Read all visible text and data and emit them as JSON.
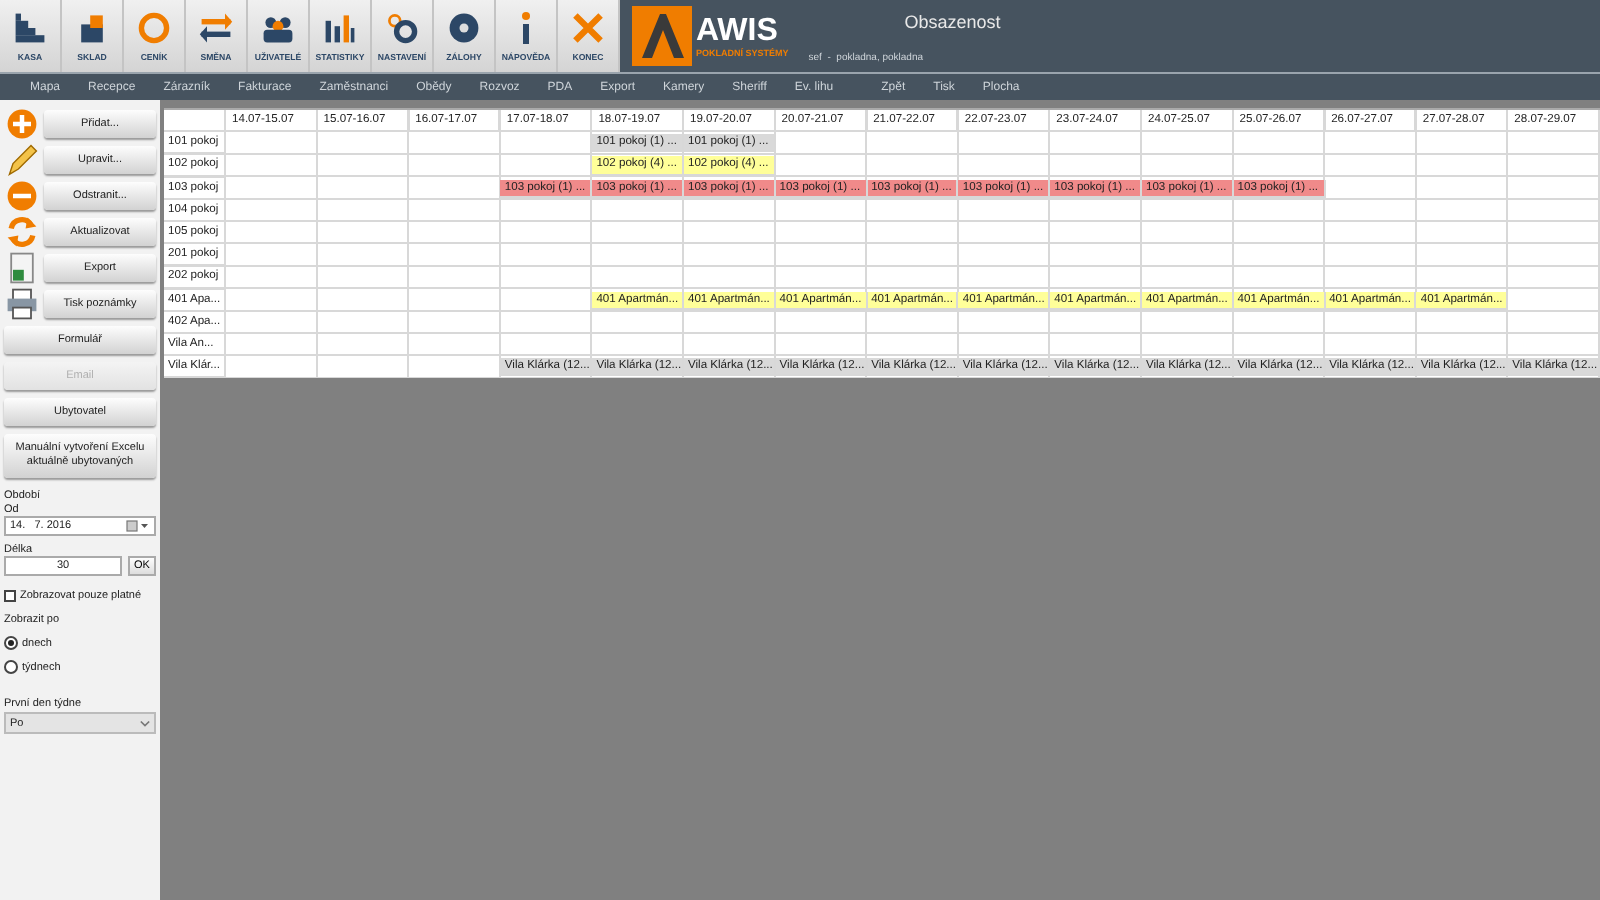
{
  "toolbar": {
    "buttons": [
      {
        "label": "KASA",
        "kind": "stairs"
      },
      {
        "label": "SKLAD",
        "kind": "box"
      },
      {
        "label": "CENÍK",
        "kind": "coin"
      },
      {
        "label": "SMĚNA",
        "kind": "swap"
      },
      {
        "label": "UŽIVATELÉ",
        "kind": "users"
      },
      {
        "label": "STATISTIKY",
        "kind": "bars"
      },
      {
        "label": "NASTAVENÍ",
        "kind": "gears"
      },
      {
        "label": "ZÁLOHY",
        "kind": "disc"
      },
      {
        "label": "NÁPOVĚDA",
        "kind": "info"
      },
      {
        "label": "KONEC",
        "kind": "close"
      }
    ]
  },
  "logo": {
    "name": "AWIS",
    "subtitle": "POKLADNÍ SYSTÉMY"
  },
  "header": {
    "title": "Obsazenost",
    "user": "sef  -  pokladna, pokladna"
  },
  "nav": {
    "items": [
      "Mapa",
      "Recepce",
      "Zárazník",
      "Fakturace",
      "Zaměstnanci",
      "Obědy",
      "Rozvoz",
      "PDA",
      "Export",
      "Kamery",
      "Sheriff",
      "Ev. lihu",
      "Zpět",
      "Tisk",
      "Plocha"
    ]
  },
  "sidebar": {
    "buttons": [
      {
        "label": "Přidat...",
        "kind": "plus",
        "disabled": false
      },
      {
        "label": "Upravit...",
        "kind": "pencil",
        "disabled": false
      },
      {
        "label": "Odstranit...",
        "kind": "minus",
        "disabled": false
      },
      {
        "label": "Aktualizovat",
        "kind": "refresh",
        "disabled": false
      },
      {
        "label": "Export",
        "kind": "sheet",
        "disabled": false
      },
      {
        "label": "Tisk poznámky",
        "kind": "printer",
        "disabled": false
      },
      {
        "label": "Formulář",
        "kind": "plain",
        "disabled": false
      },
      {
        "label": "Email",
        "kind": "plain",
        "disabled": true
      },
      {
        "label": "Ubytovatel",
        "kind": "plain",
        "disabled": false
      },
      {
        "label": "Manuální vytvoření Excelu aktuálně ubytovaných",
        "kind": "plain",
        "disabled": false
      }
    ],
    "period_label": "Období",
    "from_label": "Od",
    "from_value": "14.   7. 2016",
    "length_label": "Délka",
    "length_value": "30",
    "ok_button": "OK",
    "only_valid": {
      "label": "Zobrazovat pouze platné",
      "checked": false
    },
    "show_by_label": "Zobrazit po",
    "show_by": [
      {
        "label": "dnech",
        "selected": true
      },
      {
        "label": "týdnech",
        "selected": false
      }
    ],
    "first_day_label": "První den týdne",
    "first_day_value": "Po"
  },
  "grid": {
    "columns": [
      "14.07-15.07",
      "15.07-16.07",
      "16.07-17.07",
      "17.07-18.07",
      "18.07-19.07",
      "19.07-20.07",
      "20.07-21.07",
      "21.07-22.07",
      "22.07-23.07",
      "23.07-24.07",
      "24.07-25.07",
      "25.07-26.07",
      "26.07-27.07",
      "27.07-28.07",
      "28.07-29.07"
    ],
    "rows": [
      {
        "label": "101 pokoj",
        "cells": [
          null,
          null,
          null,
          null,
          {
            "text": "101 pokoj (1) ...",
            "color": "#d9d9d9"
          },
          {
            "text": "101 pokoj (1) ...",
            "color": "#d9d9d9"
          },
          null,
          null,
          null,
          null,
          null,
          null,
          null,
          null,
          null
        ]
      },
      {
        "label": "102 pokoj",
        "cells": [
          null,
          null,
          null,
          null,
          {
            "text": "102 pokoj (4) ...",
            "color": "#ffff99"
          },
          {
            "text": "102 pokoj (4) ...",
            "color": "#ffff99"
          },
          null,
          null,
          null,
          null,
          null,
          null,
          null,
          null,
          null
        ]
      },
      {
        "label": "103 pokoj",
        "cells": [
          null,
          null,
          null,
          {
            "text": "103 pokoj (1) ...",
            "color": "#f08a8a"
          },
          {
            "text": "103 pokoj (1) ...",
            "color": "#f08a8a"
          },
          {
            "text": "103 pokoj (1) ...",
            "color": "#f08a8a"
          },
          {
            "text": "103 pokoj (1) ...",
            "color": "#f08a8a"
          },
          {
            "text": "103 pokoj (1) ...",
            "color": "#f08a8a"
          },
          {
            "text": "103 pokoj (1) ...",
            "color": "#f08a8a"
          },
          {
            "text": "103 pokoj (1) ...",
            "color": "#f08a8a"
          },
          {
            "text": "103 pokoj (1) ...",
            "color": "#f08a8a"
          },
          {
            "text": "103 pokoj (1) ...",
            "color": "#f08a8a"
          },
          null,
          null,
          null
        ]
      },
      {
        "label": "104 pokoj",
        "cells": [
          null,
          null,
          null,
          null,
          null,
          null,
          null,
          null,
          null,
          null,
          null,
          null,
          null,
          null,
          null
        ]
      },
      {
        "label": "105 pokoj",
        "cells": [
          null,
          null,
          null,
          null,
          null,
          null,
          null,
          null,
          null,
          null,
          null,
          null,
          null,
          null,
          null
        ]
      },
      {
        "label": "201 pokoj",
        "cells": [
          null,
          null,
          null,
          null,
          null,
          null,
          null,
          null,
          null,
          null,
          null,
          null,
          null,
          null,
          null
        ]
      },
      {
        "label": "202 pokoj",
        "cells": [
          null,
          null,
          null,
          null,
          null,
          null,
          null,
          null,
          null,
          null,
          null,
          null,
          null,
          null,
          null
        ]
      },
      {
        "label": "401 Apa...",
        "cells": [
          null,
          null,
          null,
          null,
          {
            "text": "401 Apartmán...",
            "color": "#ffff99"
          },
          {
            "text": "401 Apartmán...",
            "color": "#ffff99"
          },
          {
            "text": "401 Apartmán...",
            "color": "#ffff99"
          },
          {
            "text": "401 Apartmán...",
            "color": "#ffff99"
          },
          {
            "text": "401 Apartmán...",
            "color": "#ffff99"
          },
          {
            "text": "401 Apartmán...",
            "color": "#ffff99"
          },
          {
            "text": "401 Apartmán...",
            "color": "#ffff99"
          },
          {
            "text": "401 Apartmán...",
            "color": "#ffff99"
          },
          {
            "text": "401 Apartmán...",
            "color": "#ffff99"
          },
          {
            "text": "401 Apartmán...",
            "color": "#ffff99"
          },
          null
        ]
      },
      {
        "label": "402 Apa...",
        "cells": [
          null,
          null,
          null,
          null,
          null,
          null,
          null,
          null,
          null,
          null,
          null,
          null,
          null,
          null,
          null
        ]
      },
      {
        "label": "Vila An...",
        "cells": [
          null,
          null,
          null,
          null,
          null,
          null,
          null,
          null,
          null,
          null,
          null,
          null,
          null,
          null,
          null
        ]
      },
      {
        "label": "Vila Klár...",
        "cells": [
          null,
          null,
          null,
          {
            "text": "Vila Klárka (12...",
            "color": "#d9d9d9"
          },
          {
            "text": "Vila Klárka (12...",
            "color": "#d9d9d9"
          },
          {
            "text": "Vila Klárka (12...",
            "color": "#d9d9d9"
          },
          {
            "text": "Vila Klárka (12...",
            "color": "#d9d9d9"
          },
          {
            "text": "Vila Klárka (12...",
            "color": "#d9d9d9"
          },
          {
            "text": "Vila Klárka (12...",
            "color": "#d9d9d9"
          },
          {
            "text": "Vila Klárka (12...",
            "color": "#d9d9d9"
          },
          {
            "text": "Vila Klárka (12...",
            "color": "#d9d9d9"
          },
          {
            "text": "Vila Klárka (12...",
            "color": "#d9d9d9"
          },
          {
            "text": "Vila Klárka (12...",
            "color": "#d9d9d9"
          },
          {
            "text": "Vila Klárka (12...",
            "color": "#d9d9d9"
          },
          {
            "text": "Vila Klárka (12...",
            "color": "#d9d9d9"
          }
        ]
      }
    ]
  }
}
